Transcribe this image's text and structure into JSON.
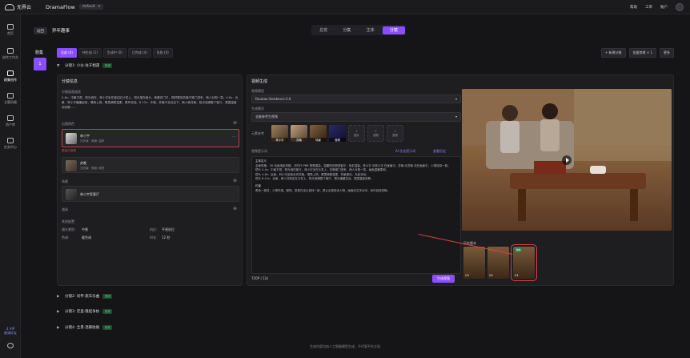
{
  "topbar": {
    "logo_text": "无界云",
    "brand": "DramaFlow",
    "project": "default",
    "right_items": [
      "帮助",
      "工单",
      "账户"
    ]
  },
  "sidebar": {
    "items": [
      {
        "label": "首页"
      },
      {
        "label": "创作工作台"
      },
      {
        "label": "剧集创作"
      },
      {
        "label": "主题风格"
      },
      {
        "label": "资产库"
      },
      {
        "label": "任务中心"
      }
    ],
    "footer_top": "4 VIP",
    "footer_bottom": "邀请好友"
  },
  "header": {
    "back_label": "返回",
    "page_title": "异年趣事",
    "tabs": [
      "总览",
      "分集",
      "主体",
      "分镜"
    ],
    "active_tab": "分镜"
  },
  "strip": {
    "title": "剧集",
    "episode_number": "1"
  },
  "filters": [
    "全部 (4)",
    "待生成 (1)",
    "生成中 (0)",
    "已完成 (4)",
    "失败 (0)"
  ],
  "right_buttons": [
    "+ 新建分镜",
    "批量剪辑 ✕ 1",
    "更多"
  ],
  "scenes": [
    {
      "label": "分镜1: 小伙·往子相遇",
      "status": "完成"
    },
    {
      "label": "分镜2: 同怀·旅车乐曲",
      "status": "完成"
    },
    {
      "label": "分镜3: 足里·隆起争执",
      "status": "完成"
    },
    {
      "label": "分镜4: 全景·温暖收尾",
      "status": "完成"
    }
  ],
  "left_panel": {
    "title": "分镜信息",
    "desc_label": "分镜画面描述",
    "desc_text": "0-8s：中景平视，阳光洒在，林小宇坐在窗边旧沙发上，阳光落在肩头，他看向门口，刚好看到苏晚宁推门进来，两人对视一笑。4-8s：近景，林小宇缓缓起身，嘴角上扬，眼里满是温柔，柔声说话。8-12s：中景，苏晚宁走近坐下，两人肩并肩，阳光洒满整个客厅，氛围温馨而安静……",
    "char_label": "出镜角色",
    "chars": [
      {
        "name": "林小宇",
        "sub": "无扮演：情绪: 温和"
      },
      {
        "name": "苏晚",
        "sub": "无扮演：情绪: 愉悦"
      }
    ],
    "char_warning": "角色已选择",
    "scene_label": "场景",
    "scene_item": "林小宇家客厅",
    "props_label": "道具",
    "extra_label": "其他配置",
    "meta": [
      {
        "k": "镜头景别：",
        "v": "中景"
      },
      {
        "k": "机位：",
        "v": "平视机位"
      },
      {
        "k": "色调：",
        "v": "暖色调"
      },
      {
        "k": "时长：",
        "v": "12 秒"
      }
    ]
  },
  "right_panel": {
    "title": "视频生成",
    "model_label": "视频模型",
    "model_value": "Doubao-Seedance-2.0",
    "mode_label": "生成模式",
    "mode_value": "全能参考生视频",
    "ref_label": "元素参考",
    "refs": [
      "林小宇",
      "苏晚",
      "场景",
      "音频"
    ],
    "ref_empty": [
      "图片",
      "视频",
      "音频"
    ],
    "prompt_label": "视频提示词",
    "prompt_actions": [
      "AI 优化提示词",
      "查看历史"
    ],
    "prompt_paragraphs": [
      {
        "h": true,
        "t": "主体定义"
      },
      {
        "h": false,
        "t": "全局风格：3D 动画电影风格，次时代 PBR 物理渲染，温暖阳光照进客厅，色彩温馨，林小宇 @林小宇 在画面中，苏晚 @苏晚 也在画面中，人物保持一致。"
      },
      {
        "h": false,
        "t": "镜头 0-4s：中景平视，阳光洒在客厅，林小宇坐在沙发上，苏晚推门进来，两人对视一笑，画面温暖柔和。"
      },
      {
        "h": false,
        "t": "镜头 4-8s：近景，林小宇起身走向苏晚，嘴角上扬，眼里满是温柔，背景虚化，光影流动。"
      },
      {
        "h": false,
        "t": "镜头 8-12s：全景，两人并肩坐在沙发上，阳光洒满整个客厅，镜头缓缓拉远，氛围温馨安静。"
      },
      {
        "h": true,
        "t": "约束"
      },
      {
        "h": false,
        "t": "角色一致性：人物外观、服饰、发型在全片保持一致，禁止出现多余人物，画面无文字水印，动作自然流畅。"
      }
    ],
    "video_ratio": "720P | 12s",
    "generate_label": "生成视频",
    "history_label": "历史版本",
    "history": [
      {
        "label": "V3",
        "badge": ""
      },
      {
        "label": "V2",
        "badge": ""
      },
      {
        "label": "V1",
        "badge": "当前"
      }
    ]
  },
  "footer": "生成内容均由人工智能模型生成，不代表平台立场"
}
